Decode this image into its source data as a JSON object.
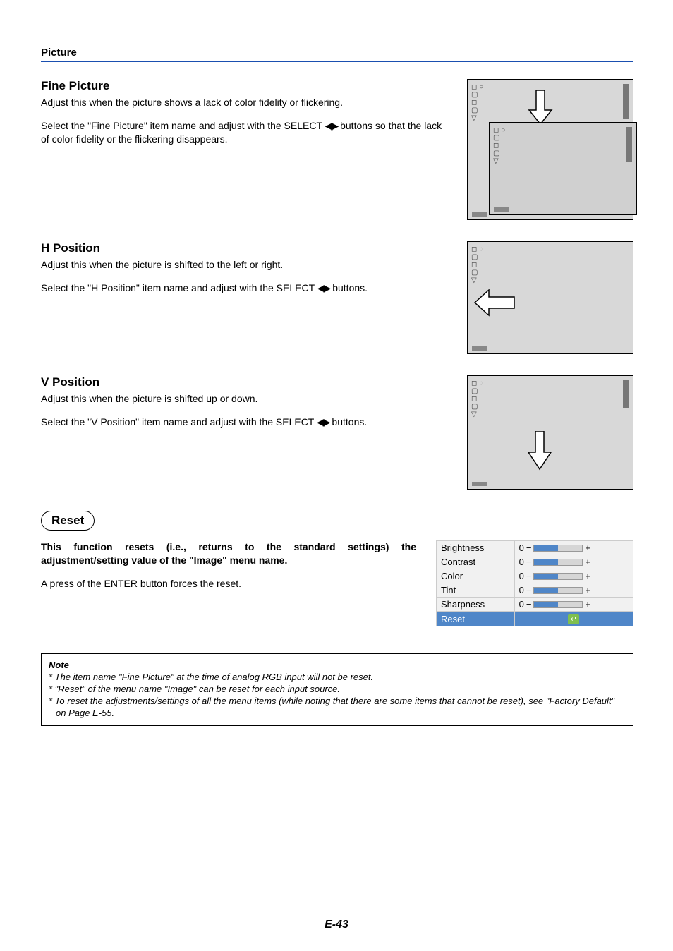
{
  "header": {
    "label": "Picture"
  },
  "fine_picture": {
    "title": "Fine Picture",
    "line1": "Adjust this when the picture shows a lack of color fidelity or flickering.",
    "line2a": "Select the \"Fine Picture\" item name and adjust with the SELECT ",
    "line2b": " buttons so that the lack of color fidelity or the flickering disappears."
  },
  "h_position": {
    "title": "H Position",
    "line1": "Adjust this when the picture is shifted to the left or right.",
    "line2a": "Select the \"H Position\" item name and adjust with the SELECT ",
    "line2b": " buttons."
  },
  "v_position": {
    "title": "V Position",
    "line1": "Adjust this when the picture is shifted up or down.",
    "line2a": "Select the \"V Position\" item name and adjust with the SELECT ",
    "line2b": " buttons."
  },
  "reset": {
    "title": "Reset",
    "bold_text": "This function resets (i.e., returns to the standard settings) the adjustment/setting value of the \"Image\" menu name.",
    "body": "A press of the ENTER button forces the reset.",
    "rows": [
      {
        "name": "Brightness",
        "val": "0"
      },
      {
        "name": "Contrast",
        "val": "0"
      },
      {
        "name": "Color",
        "val": "0"
      },
      {
        "name": "Tint",
        "val": "0"
      },
      {
        "name": "Sharpness",
        "val": "0"
      }
    ],
    "selected": {
      "name": "Reset",
      "glyph": "↵"
    }
  },
  "note": {
    "title": "Note",
    "items": [
      "* The item name \"Fine Picture\" at the time of analog RGB input will not be reset.",
      "* \"Reset\" of the menu name \"Image\" can be reset for each input source.",
      "* To reset the adjustments/settings of all the menu items (while noting that there are some items that cannot be reset), see \"Factory Default\" on Page E-55."
    ]
  },
  "glyphs": {
    "lr_arrows": "◀▶",
    "minus": "−",
    "plus": "+"
  },
  "page_number": "E-43"
}
